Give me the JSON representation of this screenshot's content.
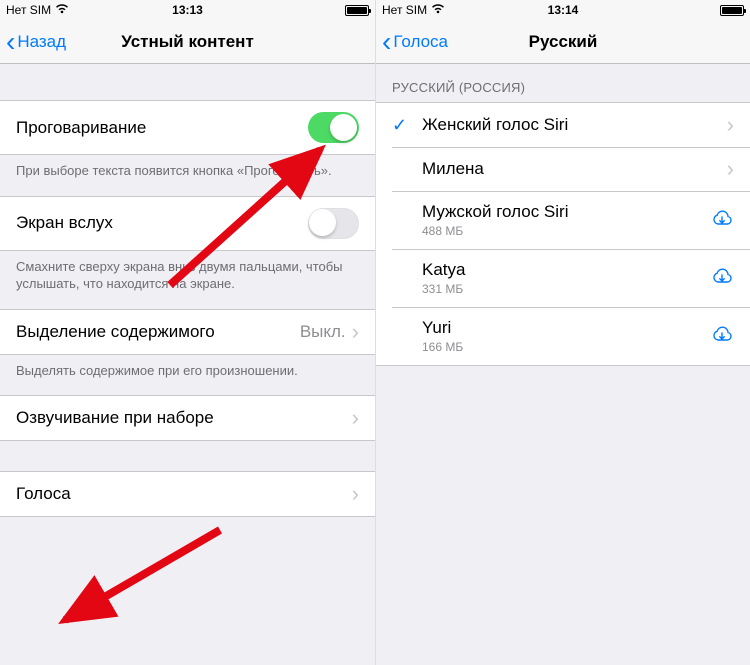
{
  "left": {
    "status": {
      "carrier": "Нет SIM",
      "time": "13:13"
    },
    "nav": {
      "back": "Назад",
      "title": "Устный контент"
    },
    "rows": {
      "speakSelection": "Проговаривание",
      "speakSelectionFooter": "При выборе текста появится кнопка «Проговорить».",
      "speakScreen": "Экран вслух",
      "speakScreenFooter": "Смахните сверху экрана вниз двумя пальцами, чтобы услышать, что находится на экране.",
      "highlight": "Выделение содержимого",
      "highlightValue": "Выкл.",
      "highlightFooter": "Выделять содержимое при его произношении.",
      "typingFeedback": "Озвучивание при наборе",
      "voices": "Голоса"
    }
  },
  "right": {
    "status": {
      "carrier": "Нет SIM",
      "time": "13:14"
    },
    "nav": {
      "back": "Голоса",
      "title": "Русский"
    },
    "sectionHeader": "РУССКИЙ (РОССИЯ)",
    "voices": [
      {
        "name": "Женский голос Siri",
        "size": "",
        "selected": true,
        "action": "disclosure"
      },
      {
        "name": "Милена",
        "size": "",
        "selected": false,
        "action": "disclosure"
      },
      {
        "name": "Мужской голос Siri",
        "size": "488 МБ",
        "selected": false,
        "action": "download"
      },
      {
        "name": "Katya",
        "size": "331 МБ",
        "selected": false,
        "action": "download"
      },
      {
        "name": "Yuri",
        "size": "166 МБ",
        "selected": false,
        "action": "download"
      }
    ]
  }
}
